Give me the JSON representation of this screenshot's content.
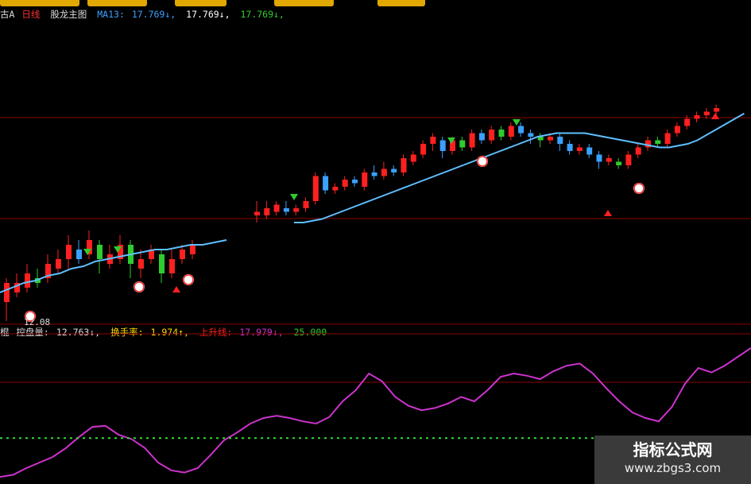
{
  "toolbar": {
    "buttons": [
      "",
      "",
      "",
      "",
      ""
    ]
  },
  "header": {
    "prefix": "古A",
    "period": "日线",
    "indicator_name": "股龙主图",
    "ma_label": "MA13:",
    "ma_val1": "17.769↓,",
    "ma_val2": "17.769↓,",
    "ma_val3": "17.769↓,"
  },
  "sub_header": {
    "prefix": "棍",
    "kpl_label": "控盘量:",
    "kpl_val": "12.763↓,",
    "hsl_label": "换手率:",
    "hsl_val": "1.974↑,",
    "ssx_label": "上升线:",
    "ssx_val": "17.979↓,",
    "line25_val": "25.000"
  },
  "price_label": "12.08",
  "watermark": {
    "title": "指标公式网",
    "url": "www.zbgs3.com"
  },
  "colors": {
    "up": "#ff2020",
    "down": "#3ba0ff",
    "down_green": "#2ecc2e",
    "ma": "#5fbfff",
    "sub_line": "#cc33cc",
    "dotted": "#33dd33",
    "grid": "#8b0000"
  },
  "chart_data": [
    {
      "type": "candlestick",
      "title": "股龙主图",
      "series": [
        {
          "name": "MA13",
          "values": [
            16.2,
            16.3,
            16.4,
            16.45,
            16.55,
            16.6,
            16.7,
            16.75,
            16.85,
            16.9,
            16.95,
            17.0,
            17.05,
            17.1,
            17.1,
            17.15,
            17.2,
            17.2,
            17.25,
            17.3
          ]
        },
        {
          "values": [
            19.0,
            19.0,
            19.05,
            19.1,
            19.2,
            19.3,
            19.4,
            19.5,
            19.6,
            19.7,
            19.8,
            19.9,
            20.0,
            20.1,
            20.2,
            20.3,
            20.4,
            20.5,
            20.6,
            20.7,
            20.8,
            20.9,
            21.0,
            21.1,
            21.2,
            21.3,
            21.4,
            21.45,
            21.5,
            21.5,
            21.5,
            21.5,
            21.45,
            21.4,
            21.35,
            21.3,
            21.25,
            21.2,
            21.15,
            21.1,
            21.1,
            21.15,
            21.2,
            21.3,
            21.45,
            21.6,
            21.75,
            21.9,
            22.05
          ]
        }
      ],
      "candles_left": [
        [
          16.0,
          16.4,
          15.6,
          16.5
        ],
        [
          16.2,
          16.4,
          16.1,
          16.6
        ],
        [
          16.3,
          16.6,
          16.2,
          16.8
        ],
        [
          16.5,
          16.4,
          16.3,
          16.7
        ],
        [
          16.5,
          16.8,
          16.4,
          17.0
        ],
        [
          16.7,
          16.9,
          16.6,
          17.1
        ],
        [
          16.9,
          17.2,
          16.7,
          17.4
        ],
        [
          17.1,
          16.9,
          16.8,
          17.3
        ],
        [
          17.0,
          17.3,
          16.9,
          17.5
        ],
        [
          17.2,
          16.9,
          16.6,
          17.3
        ],
        [
          16.8,
          17.0,
          16.7,
          17.2
        ],
        [
          16.9,
          17.2,
          16.8,
          17.4
        ],
        [
          17.2,
          16.8,
          16.5,
          17.3
        ],
        [
          16.7,
          16.9,
          16.5,
          17.1
        ],
        [
          16.9,
          17.1,
          16.8,
          17.2
        ],
        [
          17.0,
          16.6,
          16.4,
          17.1
        ],
        [
          16.6,
          16.9,
          16.5,
          17.1
        ],
        [
          16.9,
          17.1,
          16.8,
          17.2
        ],
        [
          17.0,
          17.2,
          16.9,
          17.3
        ]
      ],
      "candles_right": [
        [
          19.2,
          19.3,
          19.0,
          19.6
        ],
        [
          19.2,
          19.4,
          19.1,
          19.6
        ],
        [
          19.3,
          19.5,
          19.2,
          19.6
        ],
        [
          19.4,
          19.3,
          19.2,
          19.6
        ],
        [
          19.3,
          19.4,
          19.2,
          19.5
        ],
        [
          19.4,
          19.6,
          19.3,
          19.7
        ],
        [
          19.6,
          20.3,
          19.5,
          20.4
        ],
        [
          20.3,
          19.9,
          19.8,
          20.4
        ],
        [
          19.9,
          20.0,
          19.8,
          20.1
        ],
        [
          20.0,
          20.2,
          19.9,
          20.3
        ],
        [
          20.2,
          20.1,
          20.0,
          20.3
        ],
        [
          20.0,
          20.4,
          19.9,
          20.5
        ],
        [
          20.4,
          20.3,
          20.2,
          20.6
        ],
        [
          20.3,
          20.5,
          20.2,
          20.7
        ],
        [
          20.5,
          20.4,
          20.3,
          20.6
        ],
        [
          20.4,
          20.8,
          20.3,
          20.9
        ],
        [
          20.7,
          20.9,
          20.6,
          21.0
        ],
        [
          20.9,
          21.2,
          20.8,
          21.3
        ],
        [
          21.2,
          21.4,
          21.0,
          21.5
        ],
        [
          21.3,
          21.0,
          20.8,
          21.4
        ],
        [
          21.0,
          21.3,
          20.9,
          21.4
        ],
        [
          21.3,
          21.1,
          21.0,
          21.4
        ],
        [
          21.1,
          21.5,
          21.0,
          21.6
        ],
        [
          21.5,
          21.3,
          21.2,
          21.6
        ],
        [
          21.3,
          21.6,
          21.2,
          21.7
        ],
        [
          21.6,
          21.4,
          21.3,
          21.7
        ],
        [
          21.4,
          21.7,
          21.3,
          21.8
        ],
        [
          21.7,
          21.5,
          21.4,
          21.8
        ],
        [
          21.5,
          21.4,
          21.2,
          21.6
        ],
        [
          21.4,
          21.3,
          21.1,
          21.5
        ],
        [
          21.3,
          21.4,
          21.2,
          21.5
        ],
        [
          21.4,
          21.2,
          21.0,
          21.5
        ],
        [
          21.2,
          21.0,
          20.9,
          21.3
        ],
        [
          21.0,
          21.1,
          20.9,
          21.2
        ],
        [
          21.1,
          20.9,
          20.8,
          21.2
        ],
        [
          20.9,
          20.7,
          20.5,
          21.0
        ],
        [
          20.7,
          20.8,
          20.6,
          20.9
        ],
        [
          20.7,
          20.6,
          20.5,
          20.8
        ],
        [
          20.6,
          20.9,
          20.5,
          21.0
        ],
        [
          20.9,
          21.1,
          20.8,
          21.2
        ],
        [
          21.1,
          21.3,
          21.0,
          21.4
        ],
        [
          21.3,
          21.2,
          21.1,
          21.4
        ],
        [
          21.2,
          21.5,
          21.1,
          21.6
        ],
        [
          21.5,
          21.7,
          21.4,
          21.8
        ],
        [
          21.7,
          21.9,
          21.6,
          22.0
        ],
        [
          21.9,
          22.0,
          21.8,
          22.1
        ],
        [
          22.0,
          22.1,
          21.9,
          22.2
        ],
        [
          22.1,
          22.2,
          22.0,
          22.3
        ]
      ],
      "labels": [
        "12.08"
      ]
    },
    {
      "type": "line",
      "title": "控盘量",
      "series": [
        {
          "name": "控盘量",
          "values": [
            2,
            4,
            10,
            15,
            20,
            28,
            38,
            47,
            48,
            40,
            36,
            28,
            15,
            8,
            6,
            10,
            22,
            35,
            42,
            50,
            55,
            57,
            55,
            52,
            50,
            56,
            70,
            80,
            95,
            88,
            74,
            66,
            62,
            64,
            68,
            74,
            70,
            80,
            92,
            95,
            93,
            90,
            97,
            102,
            104,
            95,
            82,
            70,
            60,
            55,
            52,
            65,
            86,
            100,
            96,
            102,
            110,
            118
          ]
        },
        {
          "name": "上升线",
          "values": [
            25
          ]
        }
      ]
    }
  ]
}
